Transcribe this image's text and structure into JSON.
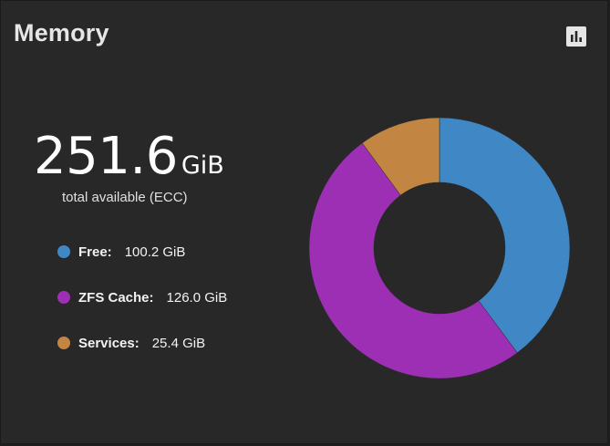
{
  "card": {
    "title": "Memory",
    "report_icon": "bar-chart-icon"
  },
  "total": {
    "value": "251.6",
    "unit": "GiB",
    "caption": "total available (ECC)"
  },
  "legend": [
    {
      "label": "Free:",
      "value": "100.2 GiB",
      "color": "#3f88c5"
    },
    {
      "label": "ZFS Cache:",
      "value": "126.0 GiB",
      "color": "#9d2fb5"
    },
    {
      "label": "Services:",
      "value": "25.4 GiB",
      "color": "#c38542"
    }
  ],
  "chart_data": {
    "type": "pie",
    "categories": [
      "Free",
      "ZFS Cache",
      "Services"
    ],
    "values": [
      100.2,
      126.0,
      25.4
    ],
    "colors": [
      "#3f88c5",
      "#9d2fb5",
      "#c38542"
    ],
    "unit": "GiB",
    "donut": true
  }
}
